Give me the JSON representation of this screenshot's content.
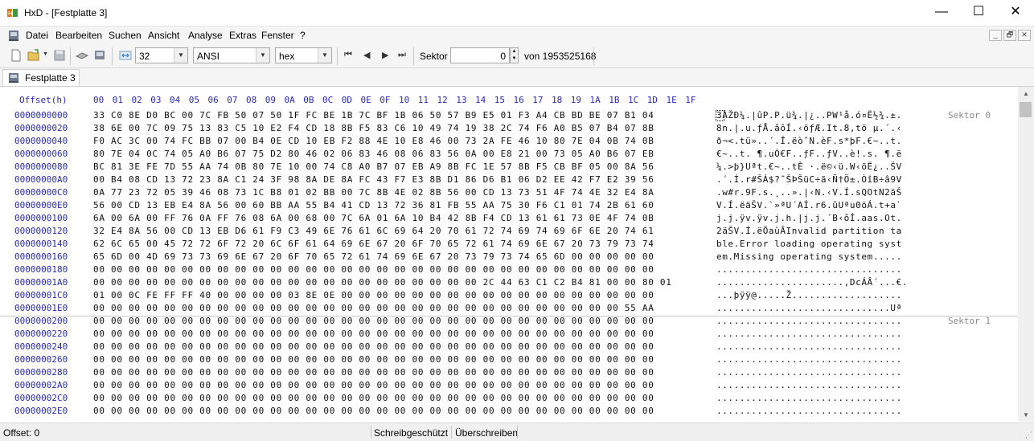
{
  "window": {
    "title": "HxD - [Festplatte 3]",
    "minimize": "—",
    "maximize": "☐",
    "close": "✕"
  },
  "menu": {
    "items": [
      "Datei",
      "Bearbeiten",
      "Suchen",
      "Ansicht",
      "Analyse",
      "Extras",
      "Fenster",
      "?"
    ],
    "mdi_buttons": [
      "_",
      "🗗",
      "✕"
    ]
  },
  "toolbar": {
    "bytes_per_row": "32",
    "charset": "ANSI",
    "offset_base": "hex",
    "sector_label": "Sektor",
    "sector_value": "0",
    "sector_total": "von 1953525168"
  },
  "tabs": [
    {
      "label": "Festplatte 3"
    }
  ],
  "editor": {
    "offset_header": "Offset(h)",
    "columns": [
      "00",
      "01",
      "02",
      "03",
      "04",
      "05",
      "06",
      "07",
      "08",
      "09",
      "0A",
      "0B",
      "0C",
      "0D",
      "0E",
      "0F",
      "10",
      "11",
      "12",
      "13",
      "14",
      "15",
      "16",
      "17",
      "18",
      "19",
      "1A",
      "1B",
      "1C",
      "1D",
      "1E",
      "1F"
    ],
    "rows": [
      {
        "offset": "0000000000",
        "hex": "33 C0 8E D0 BC 00 7C FB 50 07 50 1F FC BE 1B 7C BF 1B 06 50 57 B9 E5 01 F3 A4 CB BD BE 07 B1 04",
        "text": "3ÀŽÐ¼.|ûP.P.ü¾.|¿..PW¹å.ó¤Ë½¾.±."
      },
      {
        "offset": "0000000020",
        "hex": "38 6E 00 7C 09 75 13 83 C5 10 E2 F4 CD 18 8B F5 83 C6 10 49 74 19 38 2C 74 F6 A0 B5 07 B4 07 8B",
        "text": "8n.|.u.ƒÅ.âôÍ.‹õƒÆ.It.8,tö µ.´.‹"
      },
      {
        "offset": "0000000040",
        "hex": "F0 AC 3C 00 74 FC BB 07 00 B4 0E CD 10 EB F2 88 4E 10 E8 46 00 73 2A FE 46 10 80 7E 04 0B 74 0B",
        "text": "ð¬<.tü»..´.Í.ëòˆN.èF.s*þF.€~..t."
      },
      {
        "offset": "0000000060",
        "hex": "80 7E 04 0C 74 05 A0 B6 07 75 D2 80 46 02 06 83 46 08 06 83 56 0A 00 E8 21 00 73 05 A0 B6 07 EB",
        "text": "€~..t. ¶.uÒ€F..ƒF..ƒV..è!.s. ¶.ë"
      },
      {
        "offset": "0000000080",
        "hex": "BC 81 3E FE 7D 55 AA 74 0B 80 7E 10 00 74 C8 A0 B7 07 EB A9 8B FC 1E 57 8B F5 CB BF 05 00 8A 56",
        "text": "¼.>þ}Uªt.€~..tÈ ·.ë©‹ü.W‹õË¿..ŠV"
      },
      {
        "offset": "00000000A0",
        "hex": "00 B4 08 CD 13 72 23 8A C1 24 3F 98 8A DE 8A FC 43 F7 E3 8B D1 86 D6 B1 06 D2 EE 42 F7 E2 39 56",
        "text": ".´.Í.r#ŠÁ$?˜ŠÞŠüC÷ã‹Ñ†Ö±.ÒîB÷â9V"
      },
      {
        "offset": "00000000C0",
        "hex": "0A 77 23 72 05 39 46 08 73 1C B8 01 02 BB 00 7C 8B 4E 02 8B 56 00 CD 13 73 51 4F 74 4E 32 E4 8A",
        "text": ".w#r.9F.s.¸..».|‹N.‹V.Í.sQOtN2äŠ"
      },
      {
        "offset": "00000000E0",
        "hex": "56 00 CD 13 EB E4 8A 56 00 60 BB AA 55 B4 41 CD 13 72 36 81 FB 55 AA 75 30 F6 C1 01 74 2B 61 60",
        "text": "V.Í.ëäŠV.`»ªU´AÍ.r6.ûUªu0öÁ.t+a`"
      },
      {
        "offset": "0000000100",
        "hex": "6A 00 6A 00 FF 76 0A FF 76 08 6A 00 68 00 7C 6A 01 6A 10 B4 42 8B F4 CD 13 61 61 73 0E 4F 74 0B",
        "text": "j.j.ÿv.ÿv.j.h.|j.j.´B‹ôÍ.aas.Ot."
      },
      {
        "offset": "0000000120",
        "hex": "32 E4 8A 56 00 CD 13 EB D6 61 F9 C3 49 6E 76 61 6C 69 64 20 70 61 72 74 69 74 69 6F 6E 20 74 61",
        "text": "2äŠV.Í.ëÖaùÃInvalid partition ta"
      },
      {
        "offset": "0000000140",
        "hex": "62 6C 65 00 45 72 72 6F 72 20 6C 6F 61 64 69 6E 67 20 6F 70 65 72 61 74 69 6E 67 20 73 79 73 74",
        "text": "ble.Error loading operating syst"
      },
      {
        "offset": "0000000160",
        "hex": "65 6D 00 4D 69 73 73 69 6E 67 20 6F 70 65 72 61 74 69 6E 67 20 73 79 73 74 65 6D 00 00 00 00 00",
        "text": "em.Missing operating system....."
      },
      {
        "offset": "0000000180",
        "hex": "00 00 00 00 00 00 00 00 00 00 00 00 00 00 00 00 00 00 00 00 00 00 00 00 00 00 00 00 00 00 00 00",
        "text": "................................"
      },
      {
        "offset": "00000001A0",
        "hex": "00 00 00 00 00 00 00 00 00 00 00 00 00 00 00 00 00 00 00 00 00 00 2C 44 63 C1 C2 B4 81 00 00 80 01",
        "text": "......................,DcÁÂ´...€."
      },
      {
        "offset": "00000001C0",
        "hex": "01 00 0C FE FF FF 40 00 00 00 00 03 8E 0E 00 00 00 00 00 00 00 00 00 00 00 00 00 00 00 00 00 00",
        "text": "...þÿÿ@.....Ž..................."
      },
      {
        "offset": "00000001E0",
        "hex": "00 00 00 00 00 00 00 00 00 00 00 00 00 00 00 00 00 00 00 00 00 00 00 00 00 00 00 00 00 00 55 AA",
        "text": "..............................Uª"
      },
      {
        "offset": "0000000200",
        "hex": "00 00 00 00 00 00 00 00 00 00 00 00 00 00 00 00 00 00 00 00 00 00 00 00 00 00 00 00 00 00 00 00",
        "text": "................................"
      },
      {
        "offset": "0000000220",
        "hex": "00 00 00 00 00 00 00 00 00 00 00 00 00 00 00 00 00 00 00 00 00 00 00 00 00 00 00 00 00 00 00 00",
        "text": "................................"
      },
      {
        "offset": "0000000240",
        "hex": "00 00 00 00 00 00 00 00 00 00 00 00 00 00 00 00 00 00 00 00 00 00 00 00 00 00 00 00 00 00 00 00",
        "text": "................................"
      },
      {
        "offset": "0000000260",
        "hex": "00 00 00 00 00 00 00 00 00 00 00 00 00 00 00 00 00 00 00 00 00 00 00 00 00 00 00 00 00 00 00 00",
        "text": "................................"
      },
      {
        "offset": "0000000280",
        "hex": "00 00 00 00 00 00 00 00 00 00 00 00 00 00 00 00 00 00 00 00 00 00 00 00 00 00 00 00 00 00 00 00",
        "text": "................................"
      },
      {
        "offset": "00000002A0",
        "hex": "00 00 00 00 00 00 00 00 00 00 00 00 00 00 00 00 00 00 00 00 00 00 00 00 00 00 00 00 00 00 00 00",
        "text": "................................"
      },
      {
        "offset": "00000002C0",
        "hex": "00 00 00 00 00 00 00 00 00 00 00 00 00 00 00 00 00 00 00 00 00 00 00 00 00 00 00 00 00 00 00 00",
        "text": "................................"
      },
      {
        "offset": "00000002E0",
        "hex": "00 00 00 00 00 00 00 00 00 00 00 00 00 00 00 00 00 00 00 00 00 00 00 00 00 00 00 00 00 00 00 00",
        "text": "................................"
      }
    ],
    "sector_labels": [
      "Sektor 0",
      "Sektor 1"
    ]
  },
  "status": {
    "offset": "Offset: 0",
    "write_protect": "Schreibgeschützt",
    "mode": "Überschreiben"
  },
  "colors": {
    "offset_blue": "#2a2ab8",
    "sector_gray": "#8a8a8a"
  }
}
